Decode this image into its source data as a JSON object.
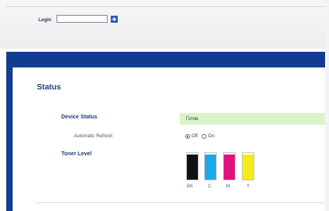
{
  "header": {
    "login_label": "Login",
    "login_value": "",
    "login_button_icon": "arrow-right-icon"
  },
  "status": {
    "title": "Status",
    "device_status_label": "Device Status",
    "device_status_value": "Готов",
    "auto_refresh_label": "Automatic Refresh",
    "refresh_options": [
      {
        "label": "Off",
        "selected": true
      },
      {
        "label": "On",
        "selected": false
      }
    ],
    "toner_label": "Toner Level",
    "toners": [
      {
        "label": "BK",
        "color": "#111111",
        "level": 0.95
      },
      {
        "label": "C",
        "color": "#1aa9e6",
        "level": 0.95
      },
      {
        "label": "M",
        "color": "#e0127e",
        "level": 0.95
      },
      {
        "label": "Y",
        "color": "#f5ea1a",
        "level": 0.95
      }
    ]
  },
  "colors": {
    "accent": "#123c91",
    "status_bg": "#d9f5c8"
  }
}
